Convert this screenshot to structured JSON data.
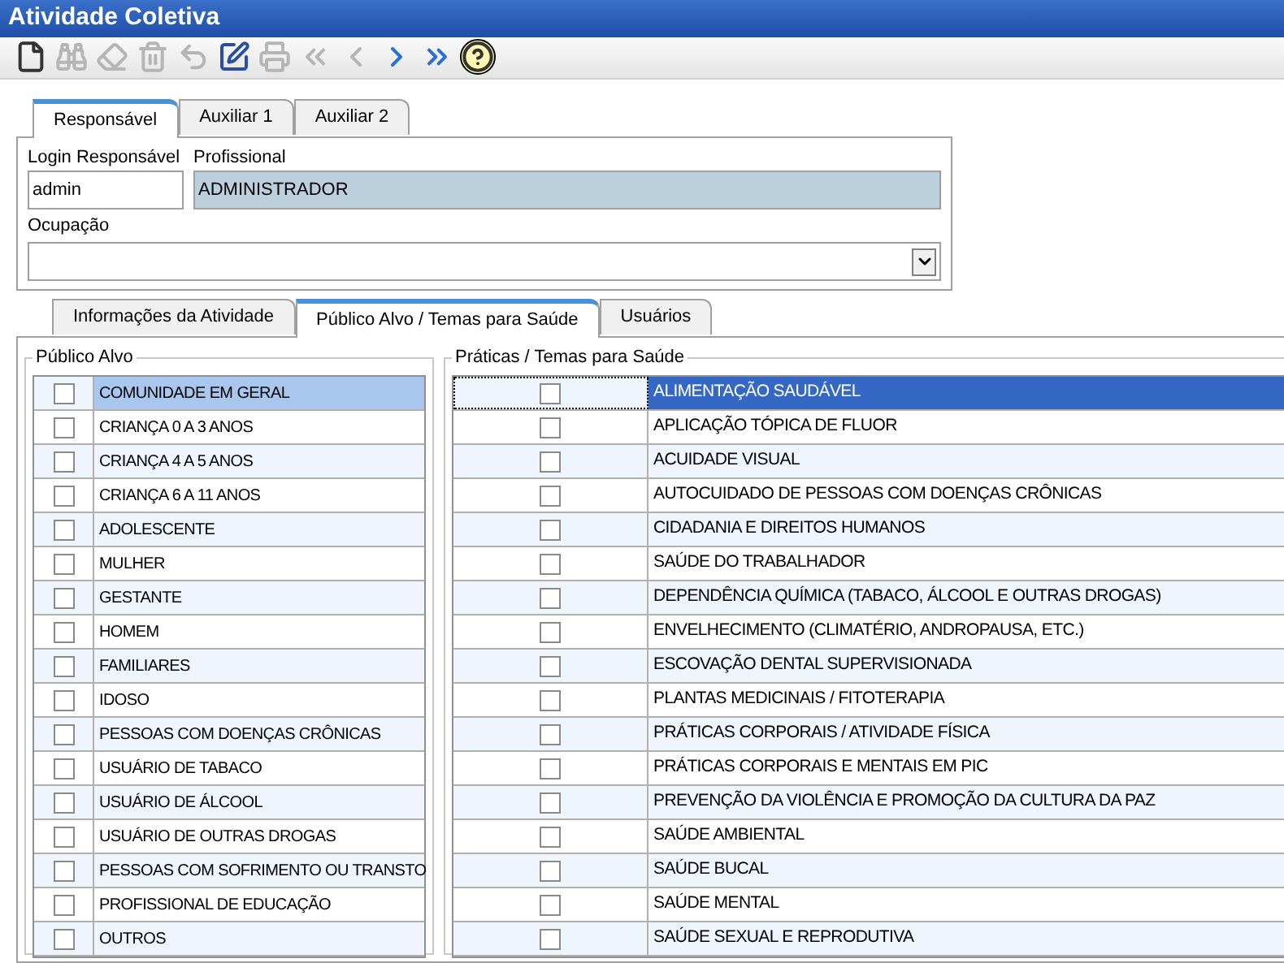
{
  "window": {
    "title": "Atividade Coletiva"
  },
  "toolbar": [
    {
      "kind": "new",
      "disabled": false
    },
    {
      "kind": "find",
      "disabled": true
    },
    {
      "kind": "erase",
      "disabled": true
    },
    {
      "kind": "delete",
      "disabled": true
    },
    {
      "kind": "undo",
      "disabled": true
    },
    {
      "kind": "edit",
      "disabled": false
    },
    {
      "kind": "print",
      "disabled": true
    },
    {
      "kind": "first",
      "disabled": true
    },
    {
      "kind": "prev",
      "disabled": true
    },
    {
      "kind": "next",
      "disabled": false
    },
    {
      "kind": "last",
      "disabled": false
    },
    {
      "kind": "help",
      "disabled": false
    }
  ],
  "top_tabs": [
    {
      "label": "Responsável",
      "selected": true
    },
    {
      "label": "Auxiliar 1",
      "selected": false
    },
    {
      "label": "Auxiliar 2",
      "selected": false
    }
  ],
  "login": {
    "label": "Login Responsável",
    "value": "admin"
  },
  "profissional": {
    "label": "Profissional",
    "value": "ADMINISTRADOR"
  },
  "ocupacao": {
    "label": "Ocupação"
  },
  "tabs": [
    {
      "label": "Informações da Atividade",
      "selected": false
    },
    {
      "label": "Público Alvo / Temas para Saúde",
      "selected": true
    },
    {
      "label": "Usuários",
      "selected": false
    }
  ],
  "publico": {
    "title": "Público Alvo",
    "rows": [
      {
        "label": "COMUNIDADE EM GERAL",
        "checked": false,
        "selected": true
      },
      {
        "label": "CRIANÇA 0 A 3 ANOS",
        "checked": false,
        "selected": false
      },
      {
        "label": "CRIANÇA 4 A 5 ANOS",
        "checked": false,
        "selected": false
      },
      {
        "label": "CRIANÇA 6 A 11 ANOS",
        "checked": false,
        "selected": false
      },
      {
        "label": "ADOLESCENTE",
        "checked": false,
        "selected": false
      },
      {
        "label": "MULHER",
        "checked": false,
        "selected": false
      },
      {
        "label": "GESTANTE",
        "checked": false,
        "selected": false
      },
      {
        "label": "HOMEM",
        "checked": false,
        "selected": false
      },
      {
        "label": "FAMILIARES",
        "checked": false,
        "selected": false
      },
      {
        "label": "IDOSO",
        "checked": false,
        "selected": false
      },
      {
        "label": "PESSOAS COM DOENÇAS CRÔNICAS",
        "checked": false,
        "selected": false
      },
      {
        "label": "USUÁRIO DE TABACO",
        "checked": false,
        "selected": false
      },
      {
        "label": "USUÁRIO DE ÁLCOOL",
        "checked": false,
        "selected": false
      },
      {
        "label": "USUÁRIO DE OUTRAS DROGAS",
        "checked": false,
        "selected": false
      },
      {
        "label": "PESSOAS COM SOFRIMENTO OU TRANSTO",
        "checked": false,
        "selected": false
      },
      {
        "label": "PROFISSIONAL DE EDUCAÇÃO",
        "checked": false,
        "selected": false
      },
      {
        "label": "OUTROS",
        "checked": false,
        "selected": false
      }
    ]
  },
  "praticas": {
    "title": "Práticas / Temas para Saúde",
    "rows": [
      {
        "label": "ALIMENTAÇÃO SAUDÁVEL",
        "checked": false,
        "selected": true
      },
      {
        "label": "APLICAÇÃO TÓPICA DE FLUOR",
        "checked": false,
        "selected": false
      },
      {
        "label": "ACUIDADE VISUAL",
        "checked": false,
        "selected": false
      },
      {
        "label": "AUTOCUIDADO DE PESSOAS COM DOENÇAS CRÔNICAS",
        "checked": false,
        "selected": false
      },
      {
        "label": "CIDADANIA E DIREITOS HUMANOS",
        "checked": false,
        "selected": false
      },
      {
        "label": "SAÚDE DO TRABALHADOR",
        "checked": false,
        "selected": false
      },
      {
        "label": "DEPENDÊNCIA QUÍMICA (TABACO, ÁLCOOL E OUTRAS DROGAS)",
        "checked": false,
        "selected": false
      },
      {
        "label": "ENVELHECIMENTO (CLIMATÉRIO, ANDROPAUSA, ETC.)",
        "checked": false,
        "selected": false
      },
      {
        "label": "ESCOVAÇÃO DENTAL SUPERVISIONADA",
        "checked": false,
        "selected": false
      },
      {
        "label": "PLANTAS MEDICINAIS / FITOTERAPIA",
        "checked": false,
        "selected": false
      },
      {
        "label": "PRÁTICAS CORPORAIS / ATIVIDADE FÍSICA",
        "checked": false,
        "selected": false
      },
      {
        "label": "PRÁTICAS CORPORAIS E MENTAIS EM PIC",
        "checked": false,
        "selected": false
      },
      {
        "label": "PREVENÇÃO DA VIOLÊNCIA E PROMOÇÃO DA CULTURA DA PAZ",
        "checked": false,
        "selected": false
      },
      {
        "label": "SAÚDE AMBIENTAL",
        "checked": false,
        "selected": false
      },
      {
        "label": "SAÚDE BUCAL",
        "checked": false,
        "selected": false
      },
      {
        "label": "SAÚDE MENTAL",
        "checked": false,
        "selected": false
      },
      {
        "label": "SAÚDE SEXUAL E REPRODUTIVA",
        "checked": false,
        "selected": false
      }
    ]
  }
}
